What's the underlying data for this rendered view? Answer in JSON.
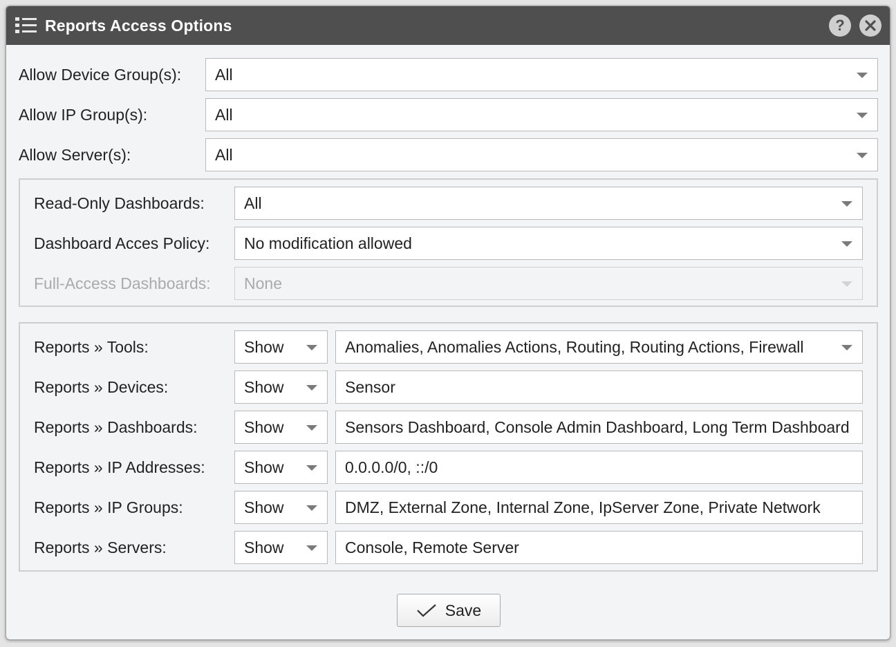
{
  "window": {
    "title": "Reports Access Options",
    "help_icon": "help-icon",
    "close_icon": "close-icon"
  },
  "top_fields": [
    {
      "label": "Allow Device Group(s):",
      "value": "All"
    },
    {
      "label": "Allow IP Group(s):",
      "value": "All"
    },
    {
      "label": "Allow Server(s):",
      "value": "All"
    }
  ],
  "dashboards": [
    {
      "label": "Read-Only Dashboards:",
      "value": "All",
      "disabled": false
    },
    {
      "label": "Dashboard Acces Policy:",
      "value": "No modification allowed",
      "disabled": false
    },
    {
      "label": "Full-Access Dashboards:",
      "value": "None",
      "disabled": true
    }
  ],
  "reports": [
    {
      "label": "Reports » Tools:",
      "mode": "Show",
      "value": "Anomalies, Anomalies Actions, Routing, Routing Actions, Firewall"
    },
    {
      "label": "Reports » Devices:",
      "mode": "Show",
      "value": "Sensor"
    },
    {
      "label": "Reports » Dashboards:",
      "mode": "Show",
      "value": "Sensors Dashboard, Console Admin Dashboard, Long Term Dashboard"
    },
    {
      "label": "Reports » IP Addresses:",
      "mode": "Show",
      "value": "0.0.0.0/0, ::/0"
    },
    {
      "label": "Reports » IP Groups:",
      "mode": "Show",
      "value": "DMZ, External Zone, Internal Zone, IpServer Zone, Private Network"
    },
    {
      "label": "Reports » Servers:",
      "mode": "Show",
      "value": "Console, Remote Server"
    }
  ],
  "save_label": "Save",
  "colors": {
    "titlebar": "#4f4f4f",
    "background": "#f3f4f5"
  }
}
